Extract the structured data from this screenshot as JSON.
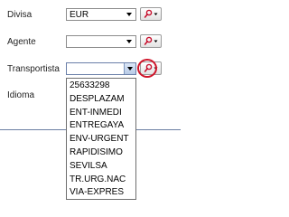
{
  "form": {
    "divisa": {
      "label": "Divisa",
      "value": "EUR"
    },
    "agente": {
      "label": "Agente",
      "value": ""
    },
    "transportista": {
      "label": "Transportista",
      "value": ""
    },
    "idioma": {
      "label": "Idioma",
      "value": ""
    }
  },
  "transportista_dropdown": {
    "options": [
      "25633298",
      "DESPLAZAM",
      "ENT-INMEDI",
      "ENTREGAYA",
      "ENV-URGENT",
      "RAPIDISIMO",
      "SEVILSA",
      "TR.URG.NAC",
      "VIA-EXPRES"
    ]
  },
  "icons": {
    "lookup": "magnifier-icon",
    "dropdown": "chevron-down-icon"
  },
  "colors": {
    "highlight_ring": "#d0152a",
    "lookup_icon_red": "#c8102e",
    "separator": "#6b7fa3"
  }
}
